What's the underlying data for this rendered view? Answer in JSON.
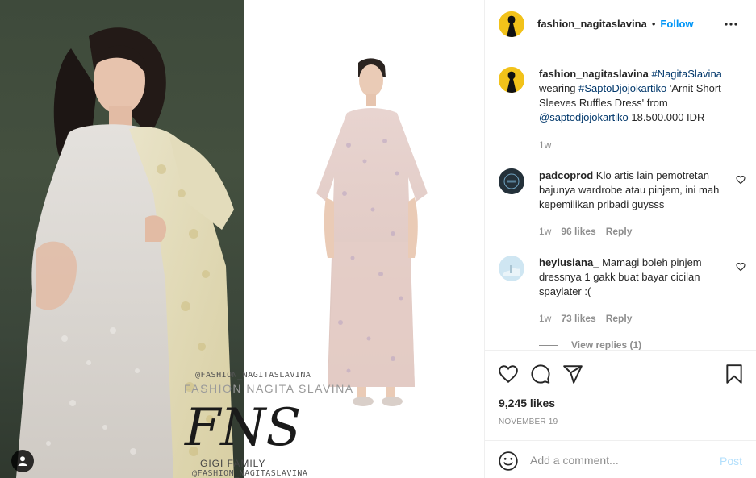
{
  "post": {
    "username": "fashion_nagitaslavina",
    "follow_label": "Follow",
    "dot": "•",
    "caption": {
      "username": "fashion_nagitaslavina",
      "parts": [
        {
          "text": "#NagitaSlavina",
          "tag": true
        },
        {
          "text": " wearing ",
          "tag": false
        },
        {
          "text": "#SaptoDjojokartiko",
          "tag": true
        },
        {
          "text": " 'Arnit Short Sleeves Ruffles Dress' from ",
          "tag": false
        },
        {
          "text": "@saptodjojokartiko",
          "tag": true
        },
        {
          "text": " 18.500.000 IDR",
          "tag": false
        }
      ],
      "time": "1w"
    },
    "comments": [
      {
        "username": "padcoprod",
        "text": "Klo artis lain pemotretan bajunya wardrobe atau pinjem, ini mah kepemilikan pribadi guysss",
        "time": "1w",
        "likes": "96 likes",
        "reply": "Reply"
      },
      {
        "username": "heylusiana_",
        "text": "Mamagi boleh pinjem dressnya 1 gakk buat bayar cicilan spaylater :(",
        "time": "1w",
        "likes": "73 likes",
        "reply": "Reply"
      }
    ],
    "view_replies": "View replies (1)",
    "likes_count": "9,245 likes",
    "date": "NOVEMBER 19",
    "add_comment_placeholder": "Add a comment...",
    "post_label": "Post"
  },
  "watermark": {
    "handle_top": "@FASHION_NAGITASLAVINA",
    "name": "FASHION NAGITA SLAVINA",
    "logo_text": "FNS",
    "family": "GIGI FAMILY",
    "handle_bottom": "@FASHION_NAGITASLAVINA"
  },
  "icons": {
    "more": "more-horizontal-icon",
    "heart": "heart-icon",
    "comment": "comment-bubble-icon",
    "share": "paper-plane-icon",
    "save": "bookmark-icon",
    "emoji": "smiley-icon",
    "user_tag": "user-tag-icon"
  },
  "colors": {
    "link_blue": "#0095f6",
    "tag_blue": "#00376b",
    "muted": "#8e8e8e",
    "post_disabled": "#b2dffc",
    "text": "#262626"
  }
}
